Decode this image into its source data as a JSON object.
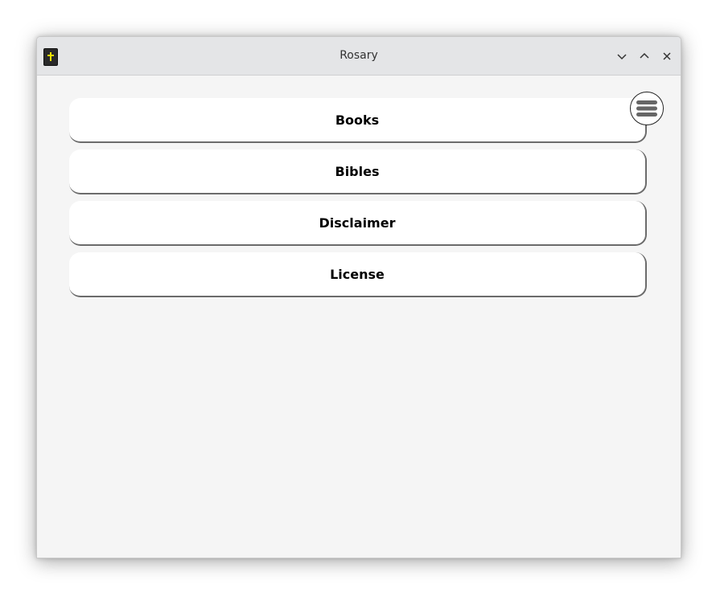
{
  "window": {
    "title": "Rosary",
    "icons": {
      "app": "bible-icon",
      "minimize": "chevron-down-icon",
      "maximize": "chevron-up-icon",
      "close": "close-icon",
      "menu": "hamburger-menu-icon"
    }
  },
  "menu": {
    "items": [
      {
        "label": "Books"
      },
      {
        "label": "Bibles"
      },
      {
        "label": "Disclaimer"
      },
      {
        "label": "License"
      }
    ]
  },
  "colors": {
    "titlebar": "#e4e5e7",
    "background": "#f5f5f5",
    "button": "#ffffff",
    "icon_cross": "#f2e200"
  }
}
